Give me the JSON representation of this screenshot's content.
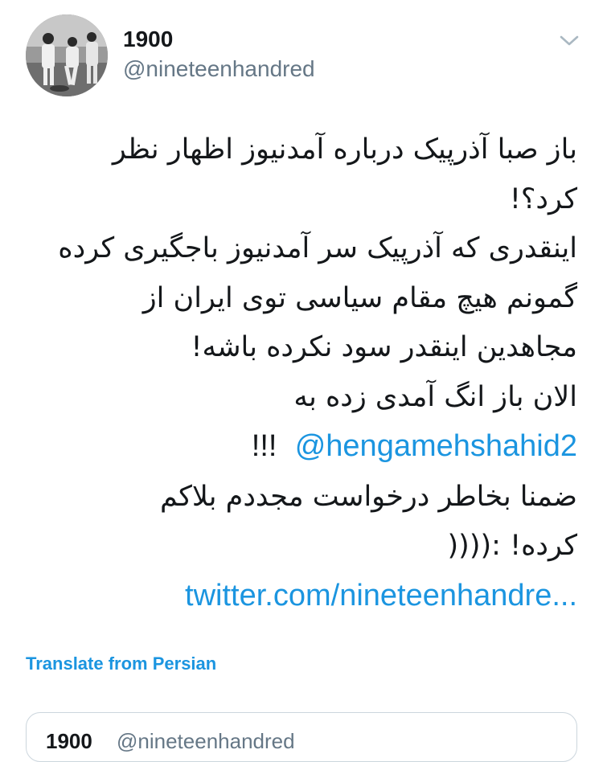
{
  "author": {
    "display_name": "1900",
    "handle": "@nineteenhandred",
    "avatar": "black-and-white-photo-avatar"
  },
  "menu": {
    "icon": "chevron-down-icon"
  },
  "tweet": {
    "lines": [
      "باز صبا آذرپیک درباره آمدنیوز اظهار نظر",
      "کرد؟!",
      "اینقدری که آذرپیک سر آمدنیوز باجگیری کرده",
      "گمونم هیچ مقام سیاسی توی ایران از",
      "مجاهدین اینقدر سود نکرده باشه!",
      "الان باز انگ آمدی زده به"
    ],
    "mention": "@hengamehshahid2",
    "mention_suffix": "!!!",
    "lines_after": [
      "ضمنا بخاطر درخواست مجددم بلاکم",
      "کرده! :((((",
      "twitter.com/nineteenhandre..."
    ]
  },
  "translate_label": "Translate from Persian",
  "quoted": {
    "display_name": "1900",
    "handle": "@nineteenhandred"
  },
  "colors": {
    "link": "#1b95e0",
    "text": "#14171a",
    "secondary": "#657786",
    "border": "#ccd6dd"
  }
}
